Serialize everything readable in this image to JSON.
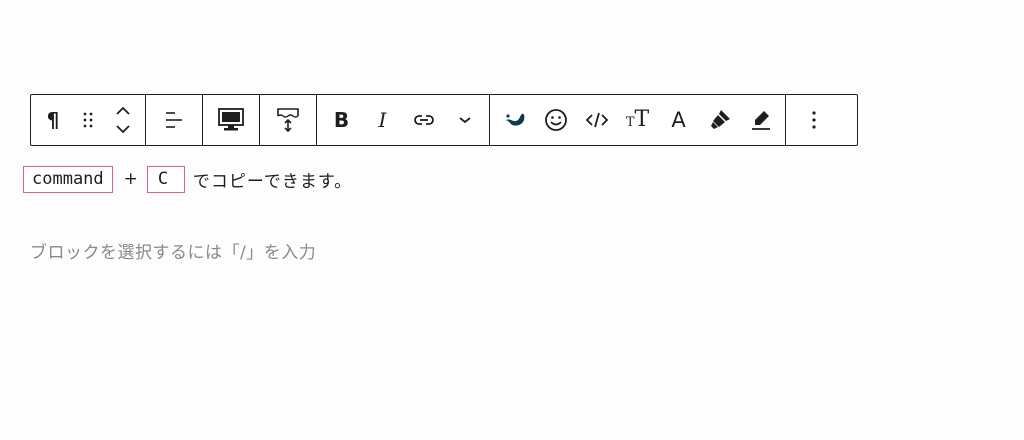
{
  "toolbar": {
    "groups": [
      [
        "paragraph-icon",
        "drag-handle-icon",
        "move-up-down-icon"
      ],
      [
        "align-left-icon"
      ],
      [
        "desktop-icon"
      ],
      [
        "block-height-icon"
      ],
      [
        "bold-icon",
        "italic-icon",
        "link-icon",
        "chevron-down-icon"
      ],
      [
        "swell-icon",
        "emoji-icon",
        "code-icon",
        "text-size-icon",
        "text-color-icon",
        "marker-icon",
        "highlight-icon"
      ],
      [
        "more-options-icon"
      ]
    ],
    "bold_label": "B",
    "italic_label": "I",
    "text_color_label": "A",
    "text_size_small": "T",
    "text_size_large": "T",
    "paragraph_glyph": "¶"
  },
  "content": {
    "key1": "command",
    "plus": "+",
    "key2": "C",
    "text": "でコピーできます。"
  },
  "placeholder": {
    "text": "ブロックを選択するには「/」を入力"
  },
  "colors": {
    "border": "#1e1e1e",
    "kbd_border": "#e05c95",
    "placeholder": "#8a8a8a",
    "swell_icon": "#0d3b52"
  }
}
